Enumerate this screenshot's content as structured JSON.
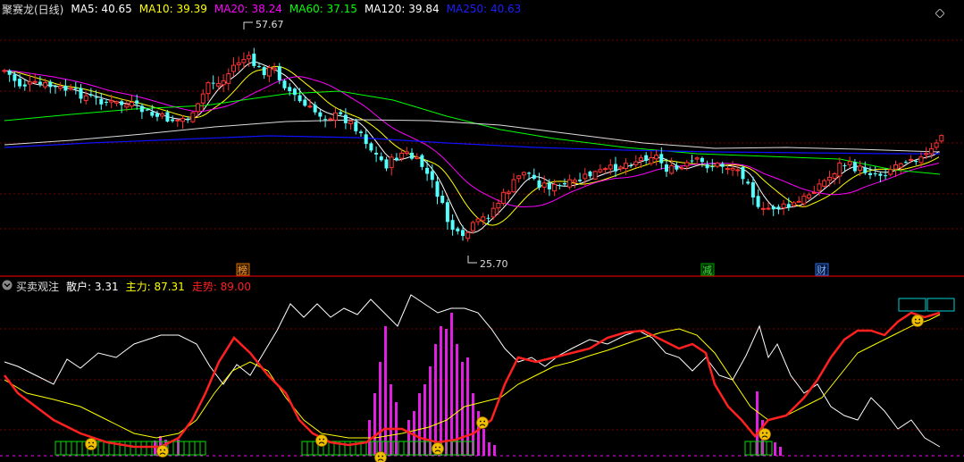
{
  "main_panel": {
    "title": "聚赛龙(日线)",
    "indicators": [
      {
        "label": "MA5: 40.65",
        "color": "#ffffff"
      },
      {
        "label": "MA10: 39.39",
        "color": "#ffff00"
      },
      {
        "label": "MA20: 38.24",
        "color": "#ff00ff"
      },
      {
        "label": "MA60: 37.15",
        "color": "#00ff00"
      },
      {
        "label": "MA120: 39.84",
        "color": "#ffffff"
      },
      {
        "label": "MA250: 40.63",
        "color": "#0000ff"
      }
    ],
    "high_label": "57.67",
    "low_label": "25.70",
    "event_markers": [
      {
        "text": "榜",
        "color": "#ff8000"
      },
      {
        "text": "减",
        "color": "#00c000"
      },
      {
        "text": "财",
        "color": "#4080ff"
      }
    ],
    "colors": {
      "up": "#ff3333",
      "down": "#54ffff",
      "ma5": "#ffffff",
      "ma10": "#ffff00",
      "ma20": "#ff00ff",
      "ma60": "#00ff00",
      "ma120": "#dddddd",
      "ma250": "#1010ff"
    }
  },
  "sub_panel": {
    "title": "买卖观注",
    "indicators": [
      {
        "label": "散户: 3.31",
        "color": "#ffffff"
      },
      {
        "label": "主力: 87.31",
        "color": "#ffff00"
      },
      {
        "label": "走势: 89.00",
        "color": "#ff2020"
      }
    ]
  },
  "icons": {
    "collapse_main": "chevron-down-icon",
    "collapse_sub": "chevron-down-icon",
    "expand": "diamond-icon"
  }
}
